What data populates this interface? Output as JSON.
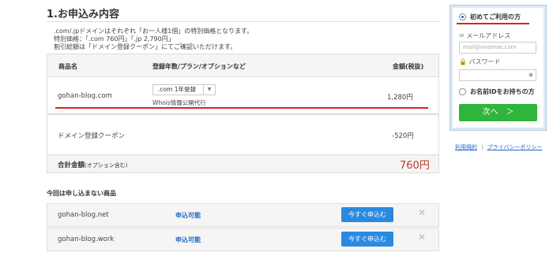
{
  "section_title": "1.お申込み内容",
  "notes": [
    ".com/.jpドメインはそれぞれ「お一人様1個」の特別価格となります。",
    "特別価格：「.com 760円」「.jp 2,790円」",
    "割引総額は「ドメイン登録クーポン」にてご確認いただけます。"
  ],
  "table": {
    "headers": {
      "product": "商品名",
      "plan": "登録年数/プラン/オプションなど",
      "amount": "金額(税抜)"
    },
    "rows": [
      {
        "name": "gohan-blog.com",
        "select_value": ".com 1年登録",
        "option": "Whois情報公開代行",
        "amount": "1,280円"
      },
      {
        "name": "ドメイン登録クーポン",
        "amount": "-520円"
      }
    ],
    "total": {
      "label": "合計金額",
      "label_sub": "(オプション含む)",
      "amount": "760円"
    }
  },
  "not_applied": {
    "title": "今回は申し込まない商品",
    "items": [
      {
        "name": "gohan-blog.net",
        "status": "申込可能",
        "button": "今すぐ申込む"
      },
      {
        "name": "gohan-blog.work",
        "status": "申込可能",
        "button": "今すぐ申込む"
      }
    ]
  },
  "login_panel": {
    "first_time": "初めてご利用の方",
    "email_label": "メールアドレス",
    "email_placeholder": "mail@onamae.com",
    "password_label": "パスワード",
    "has_id": "お名前IDをお持ちの方",
    "next_button": "次へ　＞"
  },
  "links": {
    "terms": "利用規約",
    "privacy": "プライバシーポリシー",
    "sep": "|"
  },
  "colors": {
    "accent_blue": "#1e68c4",
    "button_blue": "#2a8ae0",
    "green": "#2fb53b",
    "red_underline": "#e02020",
    "total_red": "#c0392b"
  }
}
